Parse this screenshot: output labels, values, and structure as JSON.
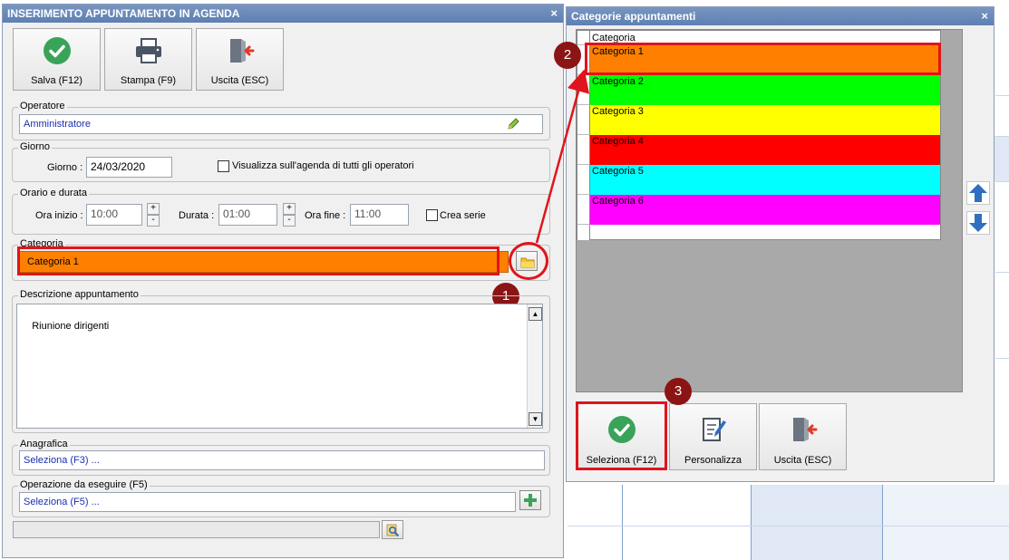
{
  "main_window": {
    "title": "INSERIMENTO APPUNTAMENTO IN AGENDA",
    "close": "×",
    "toolbar": {
      "save": "Salva (F12)",
      "print": "Stampa (F9)",
      "exit": "Uscita (ESC)"
    },
    "operatore": {
      "legend": "Operatore",
      "value": "Amministratore"
    },
    "giorno": {
      "legend": "Giorno",
      "label": "Giorno :",
      "value": "24/03/2020",
      "show_all_label": "Visualizza sull'agenda di tutti gli operatori"
    },
    "orario": {
      "legend": "Orario e durata",
      "start_label": "Ora inizio :",
      "start_value": "10:00",
      "duration_label": "Durata :",
      "duration_value": "01:00",
      "end_label": "Ora fine :",
      "end_value": "11:00",
      "series_label": "Crea serie",
      "plus": "+",
      "minus": "-"
    },
    "categoria": {
      "legend": "Categoria",
      "value": "Categoria 1",
      "color": "#ff8000"
    },
    "descrizione": {
      "legend": "Descrizione appuntamento",
      "value": "Riunione dirigenti"
    },
    "anagrafica": {
      "legend": "Anagrafica",
      "value": "Seleziona (F3) ..."
    },
    "operazione": {
      "legend": "Operazione da eseguire (F5)",
      "value": "Seleziona (F5) ..."
    }
  },
  "cat_window": {
    "title": "Categorie appuntamenti",
    "close": "×",
    "header": "Categoria",
    "categories": [
      {
        "name": "Categoria 1",
        "color": "#ff8000"
      },
      {
        "name": "Categoria 2",
        "color": "#00ff00"
      },
      {
        "name": "Categoria 3",
        "color": "#ffff00"
      },
      {
        "name": "Categoria 4",
        "color": "#ff0000"
      },
      {
        "name": "Categoria 5",
        "color": "#00ffff"
      },
      {
        "name": "Categoria 6",
        "color": "#ff00ff"
      }
    ],
    "buttons": {
      "select": "Seleziona (F12)",
      "customize": "Personalizza",
      "exit": "Uscita (ESC)"
    }
  },
  "markers": [
    "1",
    "2",
    "3"
  ],
  "colors": {
    "accent_red": "#e0141c",
    "marker": "#8b1414",
    "ok_green": "#3aa35a",
    "exit_red": "#e03a2a"
  }
}
